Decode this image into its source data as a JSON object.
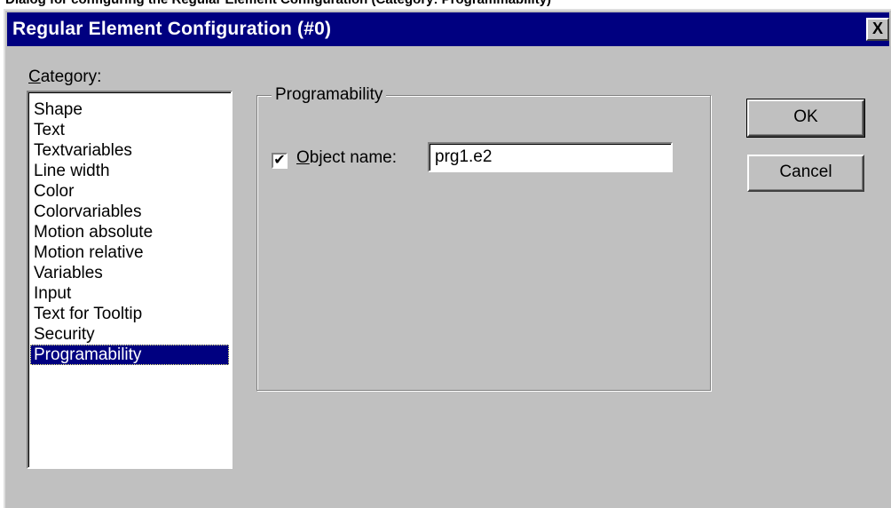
{
  "caption": "Dialog for configuring the Regular Element Configuration (Category: Programmability)",
  "window": {
    "title": "Regular Element Configuration (#0)",
    "close_label": "X"
  },
  "category": {
    "label_accel": "C",
    "label_rest": "ategory:",
    "items": [
      "Shape",
      "Text",
      "Textvariables",
      "Line width",
      "Color",
      "Colorvariables",
      "Motion absolute",
      "Motion relative",
      "Variables",
      "Input",
      "Text for Tooltip",
      "Security",
      "Programability"
    ],
    "selected": "Programability"
  },
  "group": {
    "title": "Programability",
    "object_name": {
      "checked": true,
      "check_mark": "✔",
      "label_accel": "O",
      "label_rest": "bject name:",
      "value": "prg1.e2"
    }
  },
  "buttons": {
    "ok": "OK",
    "cancel": "Cancel"
  }
}
